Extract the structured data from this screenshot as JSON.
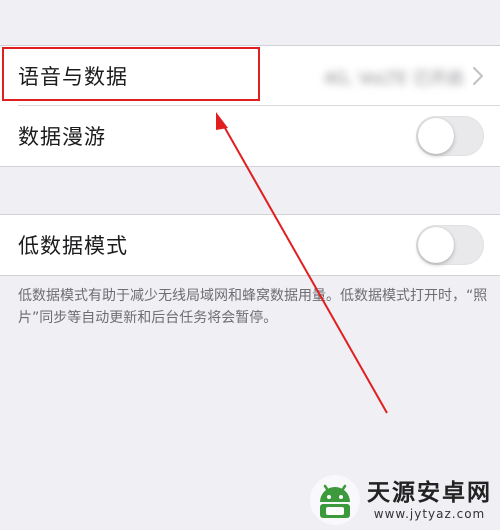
{
  "settings": {
    "voice_data": {
      "label": "语音与数据",
      "value": "4G, VoLTE 已开启",
      "icon": "chevron-right-icon"
    },
    "data_roaming": {
      "label": "数据漫游",
      "enabled": false
    },
    "low_data_mode": {
      "label": "低数据模式",
      "enabled": false
    },
    "footer_note": "低数据模式有助于减少无线局域网和蜂窝数据用量。低数据模式打开时，“照片”同步等自动更新和后台任务将会暂停。"
  },
  "annotation": {
    "highlight_color": "#e02020"
  },
  "watermark": {
    "title": "天源安卓网",
    "url": "www.jytyaz.com",
    "logo_color": "#3c9a3c"
  },
  "colors": {
    "background": "#efeff4",
    "cell": "#ffffff",
    "toggle_off": "#e9e9eb"
  }
}
